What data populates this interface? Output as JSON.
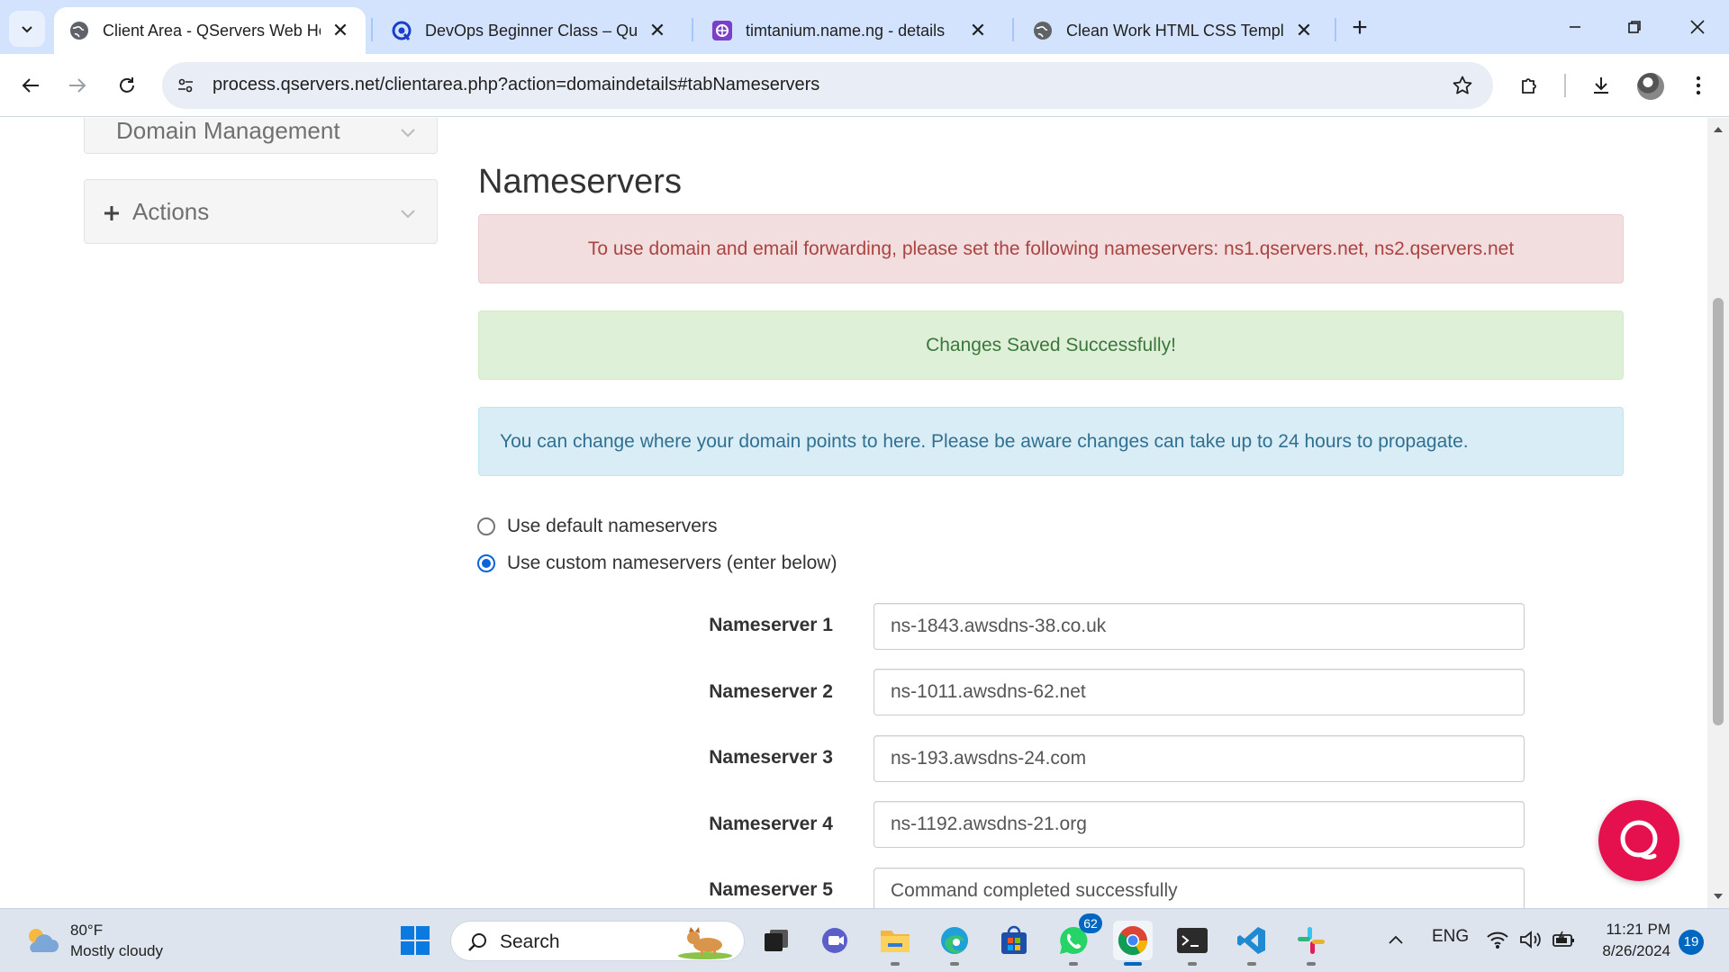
{
  "browser": {
    "tabs": [
      {
        "title": "Client Area - QServers Web Hos",
        "active": true,
        "icon": "globe-icon"
      },
      {
        "title": "DevOps Beginner Class – Qurat",
        "active": false,
        "icon": "qurat-icon"
      },
      {
        "title": "timtanium.name.ng - details",
        "active": false,
        "icon": "domain-icon"
      },
      {
        "title": "Clean Work HTML CSS Templat",
        "active": false,
        "icon": "globe-icon"
      }
    ],
    "url": "process.qservers.net/clientarea.php?action=domaindetails#tabNameservers"
  },
  "sidebar": {
    "domain_management_label": "Domain Management",
    "actions_label": "Actions"
  },
  "main": {
    "title": "Nameservers",
    "alerts": {
      "danger": "To use domain and email forwarding, please set the following nameservers: ns1.qservers.net, ns2.qservers.net",
      "success": "Changes Saved Successfully!",
      "info": "You can change where your domain points to here. Please be aware changes can take up to 24 hours to propagate."
    },
    "options": {
      "default_label": "Use default nameservers",
      "custom_label": "Use custom nameservers (enter below)",
      "selected": "custom"
    },
    "nameservers": [
      {
        "label": "Nameserver 1",
        "value": "ns-1843.awsdns-38.co.uk"
      },
      {
        "label": "Nameserver 2",
        "value": "ns-1011.awsdns-62.net"
      },
      {
        "label": "Nameserver 3",
        "value": "ns-193.awsdns-24.com"
      },
      {
        "label": "Nameserver 4",
        "value": "ns-1192.awsdns-21.org"
      },
      {
        "label": "Nameserver 5",
        "value": "Command completed successfully"
      }
    ]
  },
  "taskbar": {
    "weather_temp": "80°F",
    "weather_desc": "Mostly cloudy",
    "search_label": "Search",
    "whatsapp_badge": "62",
    "language": "ENG",
    "time": "11:21 PM",
    "date": "8/26/2024",
    "notifications": "19"
  },
  "colors": {
    "accent": "#0b63d9",
    "danger_bg": "#f2dede",
    "success_bg": "#dff0d8",
    "info_bg": "#d9edf7",
    "chat_widget": "#e5114f"
  }
}
